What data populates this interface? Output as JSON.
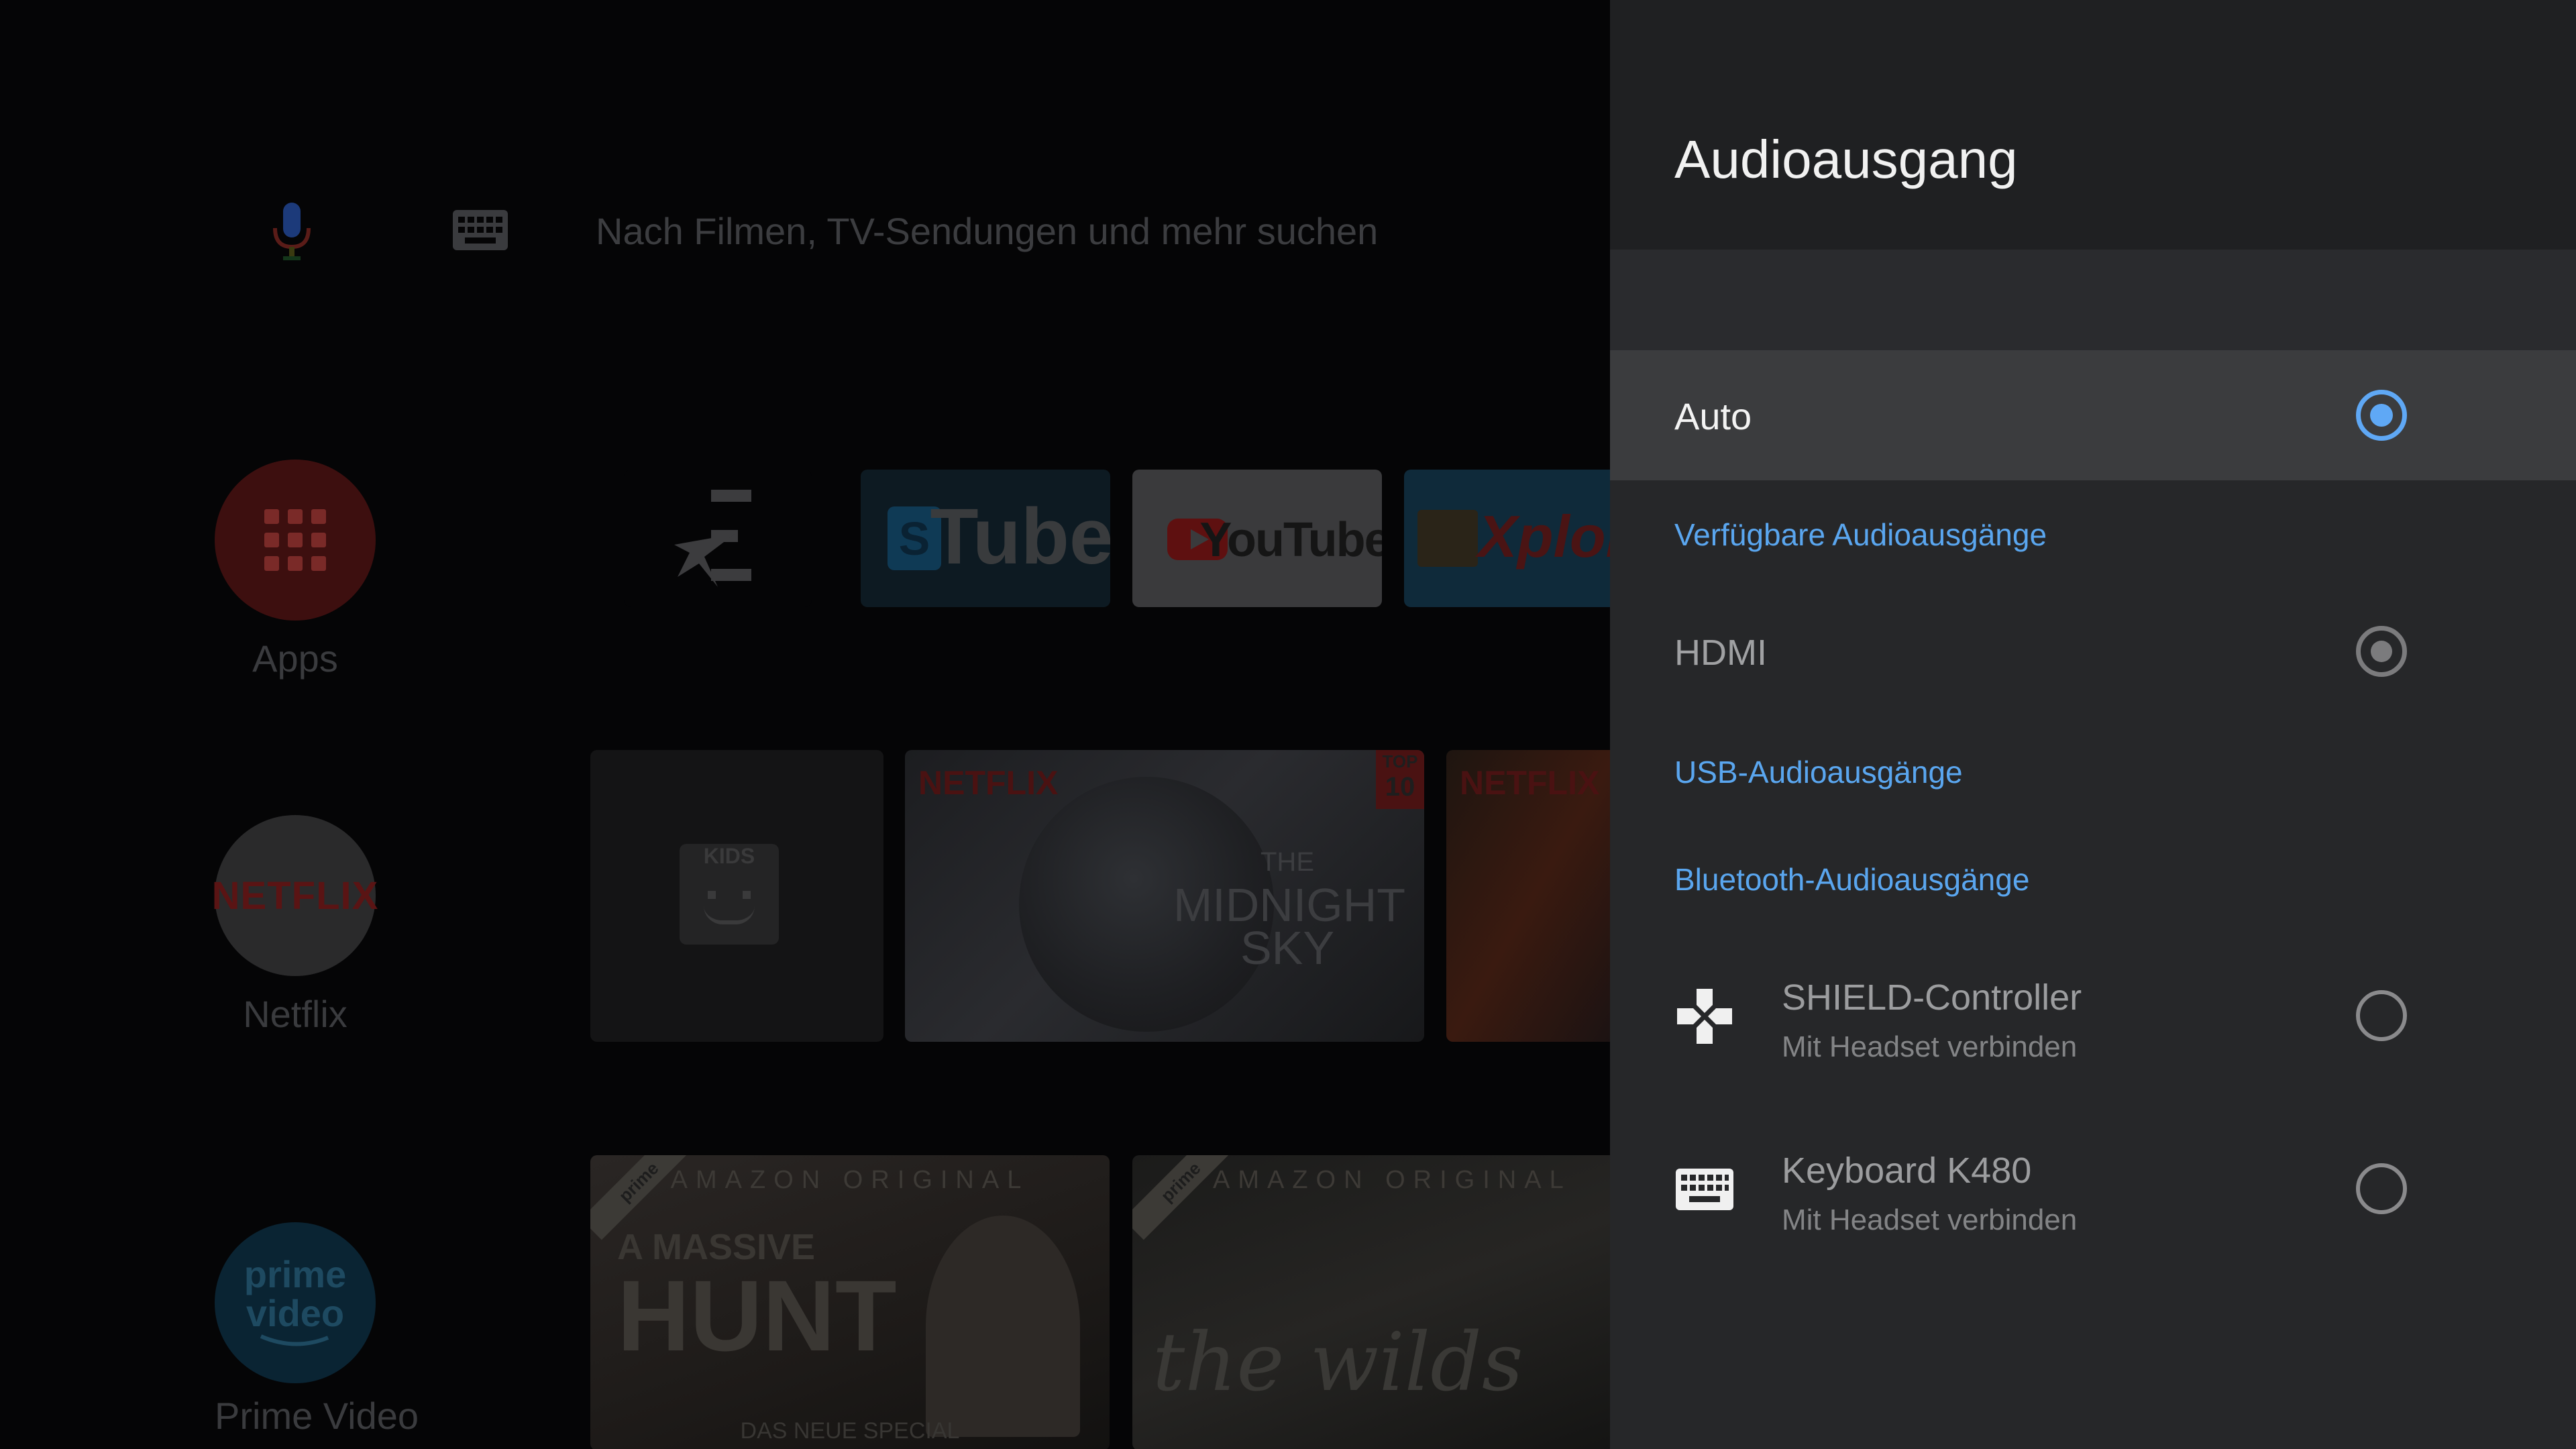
{
  "home": {
    "search_placeholder": "Nach Filmen, TV-Sendungen und mehr suchen",
    "side_apps": [
      {
        "label": "Apps"
      },
      {
        "label": "Netflix",
        "logo": "NETFLIX"
      },
      {
        "label": "Prime Video",
        "logo_top": "prime",
        "logo_bottom": "video"
      }
    ],
    "channel_tiles": [
      {
        "name": "eurosport-logo"
      },
      {
        "name": "stube",
        "text": "Tube",
        "letter": "S"
      },
      {
        "name": "youtube",
        "text": "YouTube"
      },
      {
        "name": "xplore",
        "text": "Xplor"
      }
    ],
    "netflix_row": [
      {
        "badge": "KIDS"
      },
      {
        "brand": "NETFLIX",
        "top_badge_top": "TOP",
        "top_badge_num": "10",
        "title_line1": "THE",
        "title_line2": "MIDNIGHT",
        "title_line3": "SKY"
      },
      {
        "brand": "NETFLIX"
      }
    ],
    "prime_row": [
      {
        "badge": "prime",
        "header": "AMAZON ORIGINAL",
        "title_line1": "A MASSIVE",
        "title_line2": "HUNT",
        "footer": "DAS NEUE SPECIAL"
      },
      {
        "badge": "prime",
        "header": "AMAZON ORIGINAL",
        "title": "the wilds"
      }
    ]
  },
  "panel": {
    "title": "Audioausgang",
    "options": {
      "auto": "Auto",
      "hdmi": "HDMI"
    },
    "sections": {
      "available": "Verfügbare Audioausgänge",
      "usb": "USB-Audioausgänge",
      "bluetooth": "Bluetooth-Audioausgänge"
    },
    "devices": [
      {
        "title": "SHIELD-Controller",
        "subtitle": "Mit Headset verbinden",
        "icon": "gamepad-icon"
      },
      {
        "title": "Keyboard K480",
        "subtitle": "Mit Headset verbinden",
        "icon": "keyboard-icon"
      }
    ]
  },
  "colors": {
    "accent": "#5fa8f5",
    "section_label": "#5aa6ef",
    "panel_bg": "#262729",
    "selected_row_bg": "#3b3c3e"
  }
}
